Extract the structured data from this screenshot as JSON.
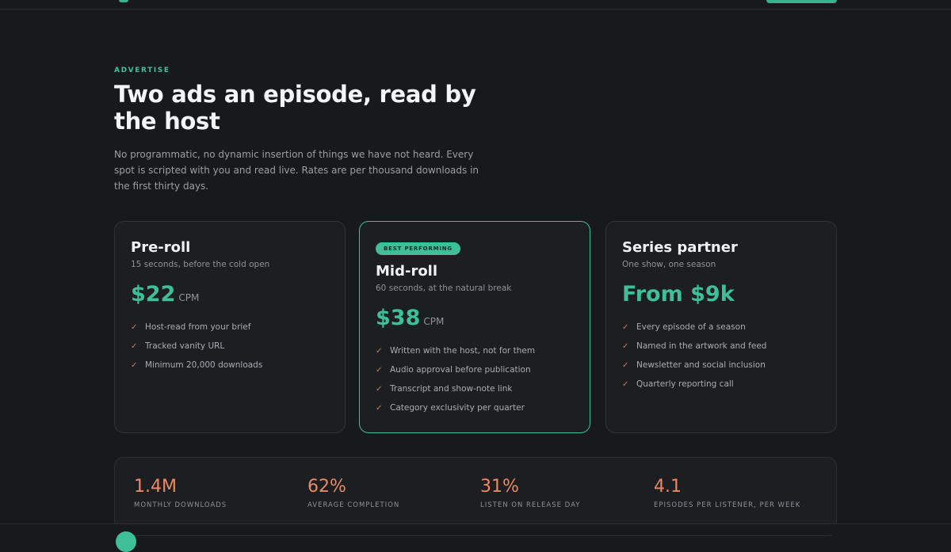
{
  "section": {
    "eyebrow": "ADVERTISE",
    "headline": "Two ads an episode, read by the host",
    "intro": "No programmatic, no dynamic insertion of things we have not heard. Every spot is scripted with you and read live. Rates are per thousand downloads in the first thirty days."
  },
  "plans": [
    {
      "title": "Pre-roll",
      "subtitle": "15 seconds, before the cold open",
      "price": "$22",
      "unit": "CPM",
      "features": [
        "Host-read from your brief",
        "Tracked vanity URL",
        "Minimum 20,000 downloads"
      ]
    },
    {
      "badge": "BEST PERFORMING",
      "title": "Mid-roll",
      "subtitle": "60 seconds, at the natural break",
      "price": "$38",
      "unit": "CPM",
      "features": [
        "Written with the host, not for them",
        "Audio approval before publication",
        "Transcript and show-note link",
        "Category exclusivity per quarter"
      ]
    },
    {
      "title": "Series partner",
      "subtitle": "One show, one season",
      "price": "From $9k",
      "features": [
        "Every episode of a season",
        "Named in the artwork and feed",
        "Newsletter and social inclusion",
        "Quarterly reporting call"
      ]
    }
  ],
  "stats": [
    {
      "value": "1.4M",
      "label": "MONTHLY DOWNLOADS"
    },
    {
      "value": "62%",
      "label": "AVERAGE COMPLETION"
    },
    {
      "value": "31%",
      "label": "LISTEN ON RELEASE DAY"
    },
    {
      "value": "4.1",
      "label": "EPISODES PER LISTENER, PER WEEK"
    }
  ],
  "icons": {
    "check": "check-icon"
  },
  "colors": {
    "accent": "#3fbf98",
    "stat": "#ea8a63",
    "check": "#d07a5a",
    "background": "#18191c"
  }
}
